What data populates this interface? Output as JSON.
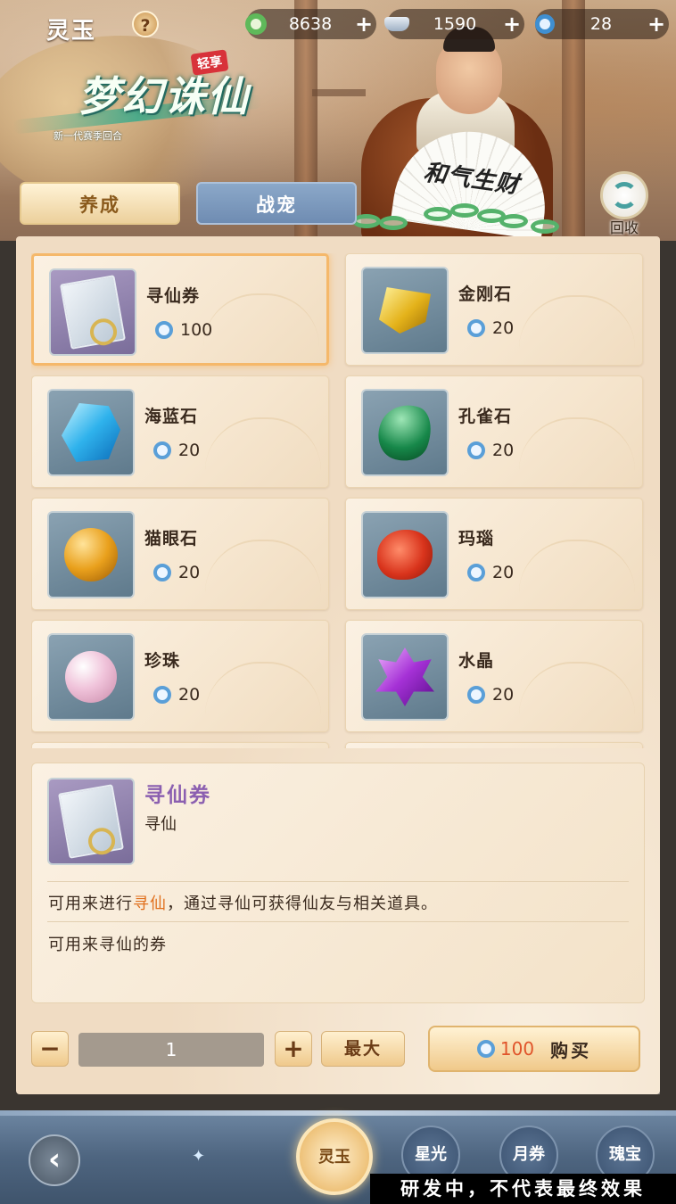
{
  "header": {
    "title": "灵玉",
    "help_label": "?",
    "currencies": [
      {
        "icon": "jade-coin-icon",
        "value": "8638",
        "plus": "+"
      },
      {
        "icon": "silver-ingot-icon",
        "value": "1590",
        "plus": "+"
      },
      {
        "icon": "spirit-jade-icon",
        "value": "28",
        "plus": "+"
      }
    ]
  },
  "banner": {
    "logo_main": "梦幻诛仙",
    "logo_badge": "轻享",
    "logo_new": "新",
    "logo_sub": "新一代赛季回合",
    "fan_text": "和气生财"
  },
  "recycle": {
    "label": "回收"
  },
  "tabs": [
    {
      "label": "养成",
      "active": true
    },
    {
      "label": "战宠",
      "active": false
    }
  ],
  "items": [
    {
      "name": "寻仙券",
      "price": "100",
      "icon": "ticket-icon",
      "selected": true
    },
    {
      "name": "金刚石",
      "price": "20",
      "icon": "gold-gem-icon"
    },
    {
      "name": "海蓝石",
      "price": "20",
      "icon": "blue-gem-icon"
    },
    {
      "name": "孔雀石",
      "price": "20",
      "icon": "green-gem-icon"
    },
    {
      "name": "猫眼石",
      "price": "20",
      "icon": "cat-eye-gem-icon"
    },
    {
      "name": "玛瑙",
      "price": "20",
      "icon": "agate-gem-icon"
    },
    {
      "name": "珍珠",
      "price": "20",
      "icon": "pearl-icon"
    },
    {
      "name": "水晶",
      "price": "20",
      "icon": "crystal-icon"
    }
  ],
  "detail": {
    "name": "寻仙券",
    "type": "寻仙",
    "desc_prefix": "可用来进行",
    "desc_highlight": "寻仙",
    "desc_suffix": "，通过寻仙可获得仙友与相关道具。",
    "note": "可用来寻仙的券"
  },
  "purchase": {
    "minus": "−",
    "quantity": "1",
    "plus": "+",
    "max_label": "最大",
    "price": "100",
    "buy_label": "购买"
  },
  "bottom_nav": {
    "back": "‹",
    "tabs": [
      {
        "label": "灵玉",
        "active": true
      },
      {
        "label": "星光"
      },
      {
        "label": "月券"
      },
      {
        "label": "瑰宝"
      }
    ]
  },
  "watermark": "研发中，不代表最终效果",
  "colors": {
    "panel_bg": "#f0dcc3",
    "detail_name": "#8b5fb0",
    "highlight": "#e0701e",
    "price_red": "#e0542a",
    "currency_blue": "#3f8fd1"
  }
}
